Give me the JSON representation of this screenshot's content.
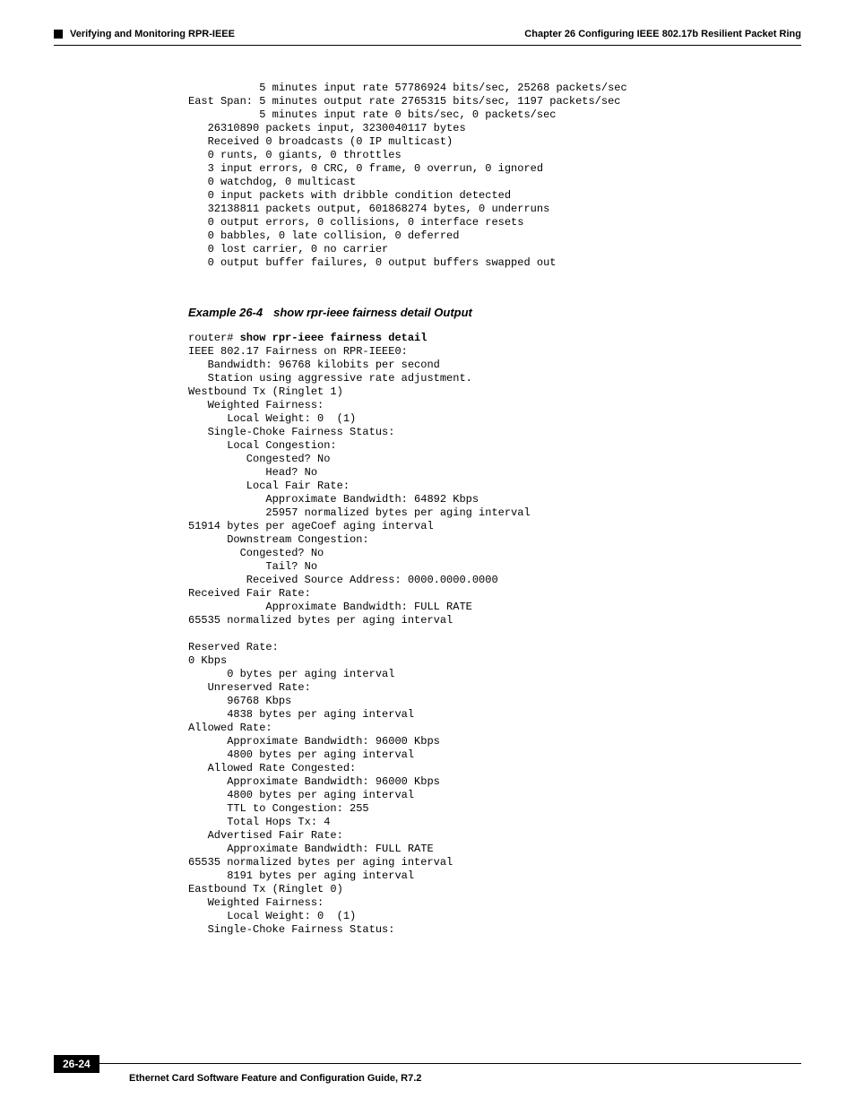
{
  "header": {
    "section": "Verifying and Monitoring RPR-IEEE",
    "chapter": "Chapter 26  Configuring IEEE 802.17b Resilient Packet Ring"
  },
  "code_block_1": "           5 minutes input rate 57786924 bits/sec, 25268 packets/sec\nEast Span: 5 minutes output rate 2765315 bits/sec, 1197 packets/sec\n           5 minutes input rate 0 bits/sec, 0 packets/sec\n   26310890 packets input, 3230040117 bytes\n   Received 0 broadcasts (0 IP multicast)\n   0 runts, 0 giants, 0 throttles\n   3 input errors, 0 CRC, 0 frame, 0 overrun, 0 ignored\n   0 watchdog, 0 multicast\n   0 input packets with dribble condition detected\n   32138811 packets output, 601868274 bytes, 0 underruns\n   0 output errors, 0 collisions, 0 interface resets\n   0 babbles, 0 late collision, 0 deferred\n   0 lost carrier, 0 no carrier\n   0 output buffer failures, 0 output buffers swapped out",
  "example": {
    "number": "Example 26-4",
    "title": "show rpr-ieee fairness detail Output"
  },
  "code_block_2_prompt": "router# ",
  "code_block_2_cmd": "show rpr-ieee fairness detail",
  "code_block_2_body": "IEEE 802.17 Fairness on RPR-IEEE0:\n   Bandwidth: 96768 kilobits per second\n   Station using aggressive rate adjustment.\nWestbound Tx (Ringlet 1)\n   Weighted Fairness:\n      Local Weight: 0  (1)\n   Single-Choke Fairness Status:\n      Local Congestion:\n         Congested? No\n            Head? No\n         Local Fair Rate:\n            Approximate Bandwidth: 64892 Kbps\n            25957 normalized bytes per aging interval\n51914 bytes per ageCoef aging interval\n      Downstream Congestion:\n        Congested? No\n            Tail? No\n         Received Source Address: 0000.0000.0000\nReceived Fair Rate:\n            Approximate Bandwidth: FULL RATE\n65535 normalized bytes per aging interval\n\nReserved Rate:\n0 Kbps\n      0 bytes per aging interval\n   Unreserved Rate:\n      96768 Kbps\n      4838 bytes per aging interval\nAllowed Rate:\n      Approximate Bandwidth: 96000 Kbps\n      4800 bytes per aging interval\n   Allowed Rate Congested:\n      Approximate Bandwidth: 96000 Kbps\n      4800 bytes per aging interval\n      TTL to Congestion: 255\n      Total Hops Tx: 4\n   Advertised Fair Rate:\n      Approximate Bandwidth: FULL RATE\n65535 normalized bytes per aging interval\n      8191 bytes per aging interval\nEastbound Tx (Ringlet 0)\n   Weighted Fairness:\n      Local Weight: 0  (1)\n   Single-Choke Fairness Status:",
  "footer": {
    "title": "Ethernet Card Software Feature and Configuration Guide, R7.2",
    "page": "26-24"
  }
}
